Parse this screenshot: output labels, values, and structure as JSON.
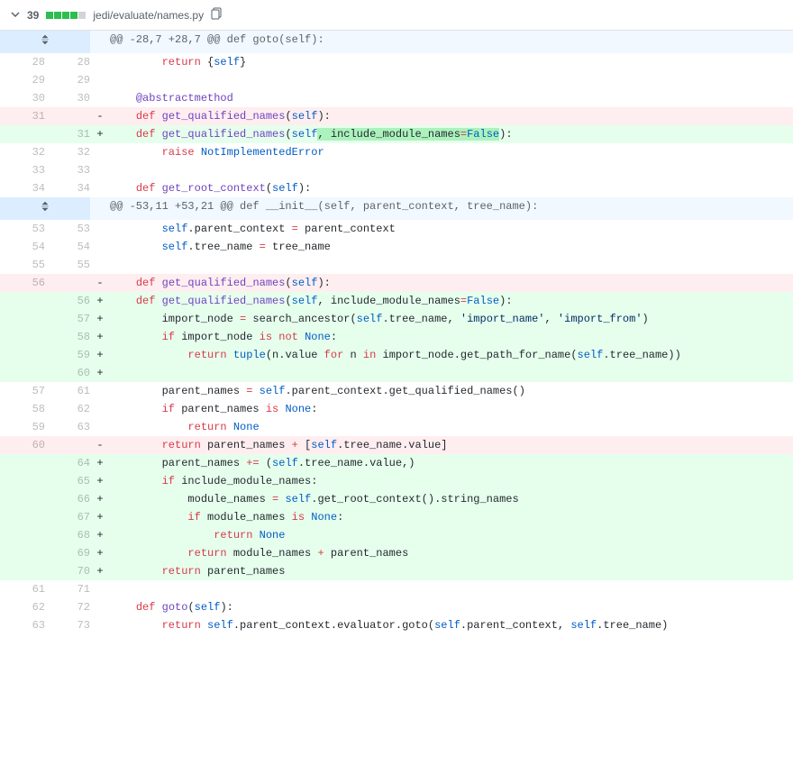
{
  "file_header": {
    "change_count": "39",
    "diffstat": [
      "a",
      "a",
      "a",
      "a",
      "n"
    ],
    "path": "jedi/evaluate/names.py"
  },
  "rows": [
    {
      "type": "hunk",
      "expand": "both",
      "text": "@@ -28,7 +28,7 @@ def goto(self):"
    },
    {
      "type": "ctx",
      "old": "28",
      "new": "28",
      "tokens": [
        {
          "t": "        "
        },
        {
          "t": "return",
          "c": "pl-k"
        },
        {
          "t": " {"
        },
        {
          "t": "self",
          "c": "pl-c1"
        },
        {
          "t": "}"
        }
      ]
    },
    {
      "type": "ctx",
      "old": "29",
      "new": "29",
      "tokens": []
    },
    {
      "type": "ctx",
      "old": "30",
      "new": "30",
      "tokens": [
        {
          "t": "    "
        },
        {
          "t": "@abstractmethod",
          "c": "pl-en"
        }
      ]
    },
    {
      "type": "del",
      "old": "31",
      "new": "",
      "tokens": [
        {
          "t": "    "
        },
        {
          "t": "def",
          "c": "pl-k"
        },
        {
          "t": " "
        },
        {
          "t": "get_qualified_names",
          "c": "pl-en"
        },
        {
          "t": "("
        },
        {
          "t": "self",
          "c": "pl-c1"
        },
        {
          "t": "):"
        }
      ]
    },
    {
      "type": "add",
      "old": "",
      "new": "31",
      "tokens": [
        {
          "t": "    "
        },
        {
          "t": "def",
          "c": "pl-k"
        },
        {
          "t": " "
        },
        {
          "t": "get_qualified_names",
          "c": "pl-en"
        },
        {
          "t": "("
        },
        {
          "t": "self",
          "c": "pl-c1"
        },
        {
          "t": ", ",
          "hl": true
        },
        {
          "t": "include_module_names",
          "hl": true
        },
        {
          "t": "=",
          "c": "pl-k",
          "hl": true
        },
        {
          "t": "False",
          "c": "pl-c1",
          "hl": true
        },
        {
          "t": "):"
        }
      ]
    },
    {
      "type": "ctx",
      "old": "32",
      "new": "32",
      "tokens": [
        {
          "t": "        "
        },
        {
          "t": "raise",
          "c": "pl-k"
        },
        {
          "t": " "
        },
        {
          "t": "NotImplementedError",
          "c": "pl-c1"
        }
      ]
    },
    {
      "type": "ctx",
      "old": "33",
      "new": "33",
      "tokens": []
    },
    {
      "type": "ctx",
      "old": "34",
      "new": "34",
      "tokens": [
        {
          "t": "    "
        },
        {
          "t": "def",
          "c": "pl-k"
        },
        {
          "t": " "
        },
        {
          "t": "get_root_context",
          "c": "pl-en"
        },
        {
          "t": "("
        },
        {
          "t": "self",
          "c": "pl-c1"
        },
        {
          "t": "):"
        }
      ]
    },
    {
      "type": "hunk",
      "expand": "both",
      "text": "@@ -53,11 +53,21 @@ def __init__(self, parent_context, tree_name):"
    },
    {
      "type": "ctx",
      "old": "53",
      "new": "53",
      "tokens": [
        {
          "t": "        "
        },
        {
          "t": "self",
          "c": "pl-c1"
        },
        {
          "t": ".parent_context "
        },
        {
          "t": "=",
          "c": "pl-k"
        },
        {
          "t": " parent_context"
        }
      ]
    },
    {
      "type": "ctx",
      "old": "54",
      "new": "54",
      "tokens": [
        {
          "t": "        "
        },
        {
          "t": "self",
          "c": "pl-c1"
        },
        {
          "t": ".tree_name "
        },
        {
          "t": "=",
          "c": "pl-k"
        },
        {
          "t": " tree_name"
        }
      ]
    },
    {
      "type": "ctx",
      "old": "55",
      "new": "55",
      "tokens": []
    },
    {
      "type": "del",
      "old": "56",
      "new": "",
      "tokens": [
        {
          "t": "    "
        },
        {
          "t": "def",
          "c": "pl-k"
        },
        {
          "t": " "
        },
        {
          "t": "get_qualified_names",
          "c": "pl-en"
        },
        {
          "t": "("
        },
        {
          "t": "self",
          "c": "pl-c1"
        },
        {
          "t": "):"
        }
      ]
    },
    {
      "type": "add",
      "old": "",
      "new": "56",
      "tokens": [
        {
          "t": "    "
        },
        {
          "t": "def",
          "c": "pl-k"
        },
        {
          "t": " "
        },
        {
          "t": "get_qualified_names",
          "c": "pl-en"
        },
        {
          "t": "("
        },
        {
          "t": "self",
          "c": "pl-c1"
        },
        {
          "t": ", "
        },
        {
          "t": "include_module_names"
        },
        {
          "t": "=",
          "c": "pl-k"
        },
        {
          "t": "False",
          "c": "pl-c1"
        },
        {
          "t": "):"
        }
      ]
    },
    {
      "type": "add",
      "old": "",
      "new": "57",
      "tokens": [
        {
          "t": "        import_node "
        },
        {
          "t": "=",
          "c": "pl-k"
        },
        {
          "t": " search_ancestor("
        },
        {
          "t": "self",
          "c": "pl-c1"
        },
        {
          "t": ".tree_name, "
        },
        {
          "t": "'import_name'",
          "c": "pl-s"
        },
        {
          "t": ", "
        },
        {
          "t": "'import_from'",
          "c": "pl-s"
        },
        {
          "t": ")"
        }
      ]
    },
    {
      "type": "add",
      "old": "",
      "new": "58",
      "tokens": [
        {
          "t": "        "
        },
        {
          "t": "if",
          "c": "pl-k"
        },
        {
          "t": " import_node "
        },
        {
          "t": "is",
          "c": "pl-k"
        },
        {
          "t": " "
        },
        {
          "t": "not",
          "c": "pl-k"
        },
        {
          "t": " "
        },
        {
          "t": "None",
          "c": "pl-c1"
        },
        {
          "t": ":"
        }
      ]
    },
    {
      "type": "add",
      "old": "",
      "new": "59",
      "tokens": [
        {
          "t": "            "
        },
        {
          "t": "return",
          "c": "pl-k"
        },
        {
          "t": " "
        },
        {
          "t": "tuple",
          "c": "pl-c1"
        },
        {
          "t": "(n.value "
        },
        {
          "t": "for",
          "c": "pl-k"
        },
        {
          "t": " n "
        },
        {
          "t": "in",
          "c": "pl-k"
        },
        {
          "t": " import_node.get_path_for_name("
        },
        {
          "t": "self",
          "c": "pl-c1"
        },
        {
          "t": ".tree_name))"
        }
      ]
    },
    {
      "type": "add",
      "old": "",
      "new": "60",
      "tokens": []
    },
    {
      "type": "ctx",
      "old": "57",
      "new": "61",
      "tokens": [
        {
          "t": "        parent_names "
        },
        {
          "t": "=",
          "c": "pl-k"
        },
        {
          "t": " "
        },
        {
          "t": "self",
          "c": "pl-c1"
        },
        {
          "t": ".parent_context.get_qualified_names()"
        }
      ]
    },
    {
      "type": "ctx",
      "old": "58",
      "new": "62",
      "tokens": [
        {
          "t": "        "
        },
        {
          "t": "if",
          "c": "pl-k"
        },
        {
          "t": " parent_names "
        },
        {
          "t": "is",
          "c": "pl-k"
        },
        {
          "t": " "
        },
        {
          "t": "None",
          "c": "pl-c1"
        },
        {
          "t": ":"
        }
      ]
    },
    {
      "type": "ctx",
      "old": "59",
      "new": "63",
      "tokens": [
        {
          "t": "            "
        },
        {
          "t": "return",
          "c": "pl-k"
        },
        {
          "t": " "
        },
        {
          "t": "None",
          "c": "pl-c1"
        }
      ]
    },
    {
      "type": "del",
      "old": "60",
      "new": "",
      "tokens": [
        {
          "t": "        "
        },
        {
          "t": "return",
          "c": "pl-k"
        },
        {
          "t": " parent_names "
        },
        {
          "t": "+",
          "c": "pl-k"
        },
        {
          "t": " ["
        },
        {
          "t": "self",
          "c": "pl-c1"
        },
        {
          "t": ".tree_name.value]"
        }
      ]
    },
    {
      "type": "add",
      "old": "",
      "new": "64",
      "tokens": [
        {
          "t": "        parent_names "
        },
        {
          "t": "+=",
          "c": "pl-k"
        },
        {
          "t": " ("
        },
        {
          "t": "self",
          "c": "pl-c1"
        },
        {
          "t": ".tree_name.value,)"
        }
      ]
    },
    {
      "type": "add",
      "old": "",
      "new": "65",
      "tokens": [
        {
          "t": "        "
        },
        {
          "t": "if",
          "c": "pl-k"
        },
        {
          "t": " include_module_names:"
        }
      ]
    },
    {
      "type": "add",
      "old": "",
      "new": "66",
      "tokens": [
        {
          "t": "            module_names "
        },
        {
          "t": "=",
          "c": "pl-k"
        },
        {
          "t": " "
        },
        {
          "t": "self",
          "c": "pl-c1"
        },
        {
          "t": ".get_root_context().string_names"
        }
      ]
    },
    {
      "type": "add",
      "old": "",
      "new": "67",
      "tokens": [
        {
          "t": "            "
        },
        {
          "t": "if",
          "c": "pl-k"
        },
        {
          "t": " module_names "
        },
        {
          "t": "is",
          "c": "pl-k"
        },
        {
          "t": " "
        },
        {
          "t": "None",
          "c": "pl-c1"
        },
        {
          "t": ":"
        }
      ]
    },
    {
      "type": "add",
      "old": "",
      "new": "68",
      "tokens": [
        {
          "t": "                "
        },
        {
          "t": "return",
          "c": "pl-k"
        },
        {
          "t": " "
        },
        {
          "t": "None",
          "c": "pl-c1"
        }
      ]
    },
    {
      "type": "add",
      "old": "",
      "new": "69",
      "tokens": [
        {
          "t": "            "
        },
        {
          "t": "return",
          "c": "pl-k"
        },
        {
          "t": " module_names "
        },
        {
          "t": "+",
          "c": "pl-k"
        },
        {
          "t": " parent_names"
        }
      ]
    },
    {
      "type": "add",
      "old": "",
      "new": "70",
      "tokens": [
        {
          "t": "        "
        },
        {
          "t": "return",
          "c": "pl-k"
        },
        {
          "t": " parent_names"
        }
      ]
    },
    {
      "type": "ctx",
      "old": "61",
      "new": "71",
      "tokens": []
    },
    {
      "type": "ctx",
      "old": "62",
      "new": "72",
      "tokens": [
        {
          "t": "    "
        },
        {
          "t": "def",
          "c": "pl-k"
        },
        {
          "t": " "
        },
        {
          "t": "goto",
          "c": "pl-en"
        },
        {
          "t": "("
        },
        {
          "t": "self",
          "c": "pl-c1"
        },
        {
          "t": "):"
        }
      ]
    },
    {
      "type": "ctx",
      "old": "63",
      "new": "73",
      "tokens": [
        {
          "t": "        "
        },
        {
          "t": "return",
          "c": "pl-k"
        },
        {
          "t": " "
        },
        {
          "t": "self",
          "c": "pl-c1"
        },
        {
          "t": ".parent_context.evaluator.goto("
        },
        {
          "t": "self",
          "c": "pl-c1"
        },
        {
          "t": ".parent_context, "
        },
        {
          "t": "self",
          "c": "pl-c1"
        },
        {
          "t": ".tree_name)"
        }
      ]
    }
  ]
}
